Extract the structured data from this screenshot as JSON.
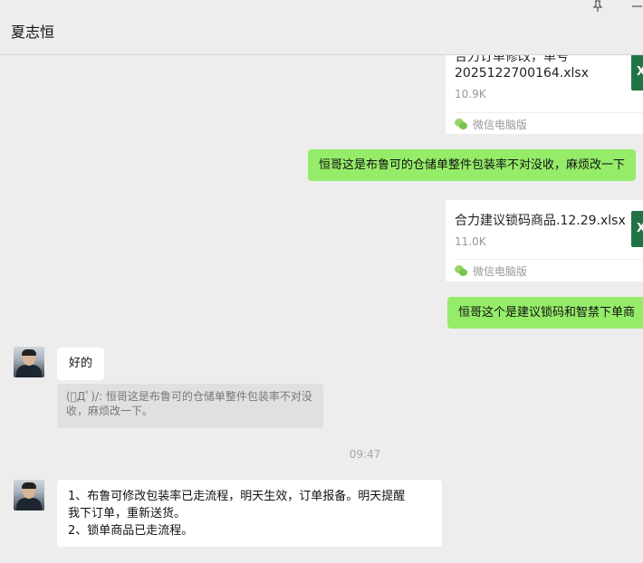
{
  "header": {
    "title": "夏志恒",
    "pin_icon": "pin-icon",
    "minimize_icon": "minimize-icon"
  },
  "messages": {
    "file1": {
      "name_line1": "合力订单修改，单号",
      "name_line2": "2025122700164.xlsx",
      "size": "10.9K",
      "source": "微信电脑版",
      "icon": "excel-file-icon"
    },
    "msg1": {
      "text": "恒哥这是布鲁可的仓储单整件包装率不对没收，麻烦改一下"
    },
    "file2": {
      "name": "合力建议锁码商品.12.29.xlsx",
      "size": "11.0K",
      "source": "微信电脑版",
      "icon": "excel-file-icon"
    },
    "msg2": {
      "text": "恒哥这个是建议锁码和智禁下单商"
    },
    "reply1": {
      "text": "好的",
      "quote_line1": "(ﾟДﾟ)/: 恒哥这是布鲁可的仓储单整件包装率不对没",
      "quote_line2": "收，麻烦改一下。"
    },
    "time": "09:47",
    "reply2": {
      "line1": "1、布鲁可修改包装率已走流程，明天生效，订单报备。明天提醒",
      "line2": "我下订单，重新送货。",
      "line3": "2、锁单商品已走流程。"
    }
  },
  "colors": {
    "background": "#ededed",
    "sent_bubble": "#95ec69",
    "received_bubble": "#ffffff",
    "excel": "#217346"
  }
}
